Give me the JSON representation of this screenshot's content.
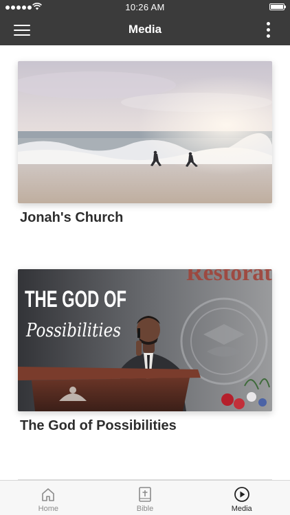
{
  "status_bar": {
    "time": "10:26 AM"
  },
  "nav": {
    "title": "Media",
    "menu_icon": "hamburger-menu-icon",
    "more_icon": "more-vertical-icon"
  },
  "media_items": [
    {
      "title": "Jonah's Church",
      "thumbnail": "two people running into waves at the beach"
    },
    {
      "title": "The God of Possibilities",
      "thumbnail_heading": "THE GOD OF",
      "thumbnail_script": "Possibilities"
    }
  ],
  "tab_bar": {
    "tabs": [
      {
        "label": "Home",
        "icon": "home-icon",
        "active": false
      },
      {
        "label": "Bible",
        "icon": "bible-icon",
        "active": false
      },
      {
        "label": "Media",
        "icon": "play-circle-icon",
        "active": true
      }
    ]
  },
  "colors": {
    "header": "#3b3b3b",
    "tab_bar": "#f7f7f7",
    "title_text": "#2d2d2d",
    "inactive_tab": "#8a8a8a",
    "active_tab": "#222222"
  }
}
